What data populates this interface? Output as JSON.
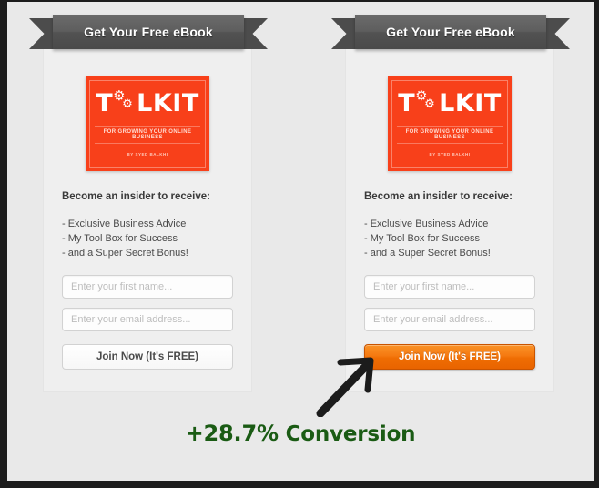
{
  "page": {
    "background_color": "#e9e9e9",
    "frame_color": "#1c1c1c"
  },
  "cards": [
    {
      "id": "control",
      "ribbon_label": "Get Your Free eBook",
      "book": {
        "title_prefix": "T",
        "title_suffix": "LKIT",
        "subtitle": "FOR GROWING YOUR ONLINE BUSINESS",
        "author": "BY SYED BALKHI",
        "cover_color": "#f8401a"
      },
      "headline": "Become an insider to receive:",
      "bullets": [
        "- Exclusive Business Advice",
        "- My Tool Box for Success",
        "- and a Super Secret Bonus!"
      ],
      "first_name_placeholder": "Enter your first name...",
      "email_placeholder": "Enter your email address...",
      "button_label": "Join Now (It's FREE)",
      "button_style": "plain"
    },
    {
      "id": "variation",
      "ribbon_label": "Get Your Free eBook",
      "book": {
        "title_prefix": "T",
        "title_suffix": "LKIT",
        "subtitle": "FOR GROWING YOUR ONLINE BUSINESS",
        "author": "BY SYED BALKHI",
        "cover_color": "#f8401a"
      },
      "headline": "Become an insider to receive:",
      "bullets": [
        "- Exclusive Business Advice",
        "- My Tool Box for Success",
        "- and a Super Secret Bonus!"
      ],
      "first_name_placeholder": "Enter your first name...",
      "email_placeholder": "Enter your email address...",
      "button_label": "Join Now (It's FREE)",
      "button_style": "orange",
      "button_color": "#f57a11"
    }
  ],
  "annotation": {
    "arrow": "up-right-arrow",
    "conversion_value": "+28.7%",
    "conversion_label": " Conversion",
    "conversion_color": "#1a5b14"
  }
}
